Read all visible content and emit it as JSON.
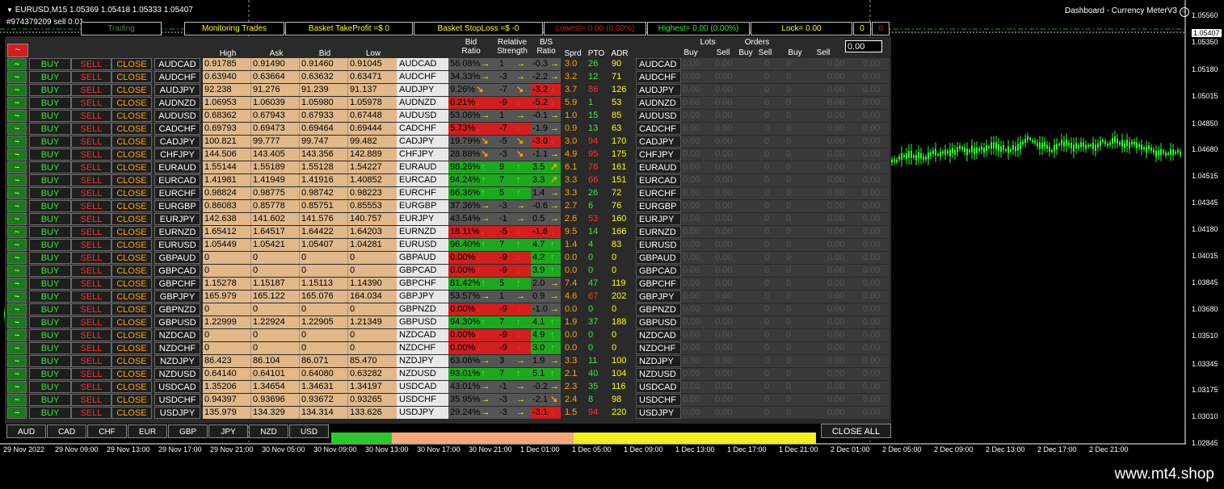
{
  "window": {
    "symbol_line": "EURUSD,M15  1.05369 1.05418 1.05333 1.05407",
    "account_line": "#974379209 sell 0.01",
    "indicator_name": "Dashboard - Currency MeterV3"
  },
  "top_bar": {
    "trading": "Trading",
    "monitoring": "Monitoring Trades",
    "basket_tp": "Basket TakeProfit =$ 0",
    "basket_sl": "Basket StopLoss =$ -0",
    "lowest": "Lowest= 0.00 (0.00%)",
    "highest": "Highest= 0.00 (0.00%)",
    "lock": "Lock= 0.00",
    "zero1": "0",
    "zero2": "0",
    "input_value": "0.00"
  },
  "headers": {
    "high": "High",
    "ask": "Ask",
    "bid": "Bid",
    "low": "Low",
    "bid_ratio_1": "Bid",
    "bid_ratio_2": "Ratio",
    "rel_1": "Relative",
    "rel_2": "Strength",
    "bs_1": "B/S",
    "bs_2": "Ratio",
    "sprd": "Sprd",
    "pto": "PTO",
    "adr": "ADR",
    "lots": "Lots",
    "orders": "Orders",
    "buy1": "Buy",
    "sell1": "Sell",
    "buy2": "Buy",
    "sell2": "Sell",
    "buy3": "Buy",
    "sell3": "Sell"
  },
  "buttons": {
    "buy": "BUY",
    "sell": "SELL",
    "close": "CLOSE",
    "toggle": "~",
    "close_all": "CLOSE ALL"
  },
  "colors": {
    "up": "#1fa81f",
    "down": "#d11f1f",
    "neutral": "#555555",
    "price_bg": "#e0b88a",
    "arrow_up": "#33ee33",
    "arrow_down": "#ff3030",
    "arrow_right": "#ffff00",
    "arrow_diag": "#ffa500"
  },
  "rows": [
    {
      "sym": "AUDCAD",
      "high": "0.91785",
      "ask": "0.91490",
      "bid": "0.91460",
      "low": "0.91045",
      "ratio": "56.08%",
      "rs": "1",
      "rs_dir": "r",
      "bs": "-0.3",
      "bs_dir": "r",
      "sprd": "3.0",
      "pto": "26",
      "adr": "90"
    },
    {
      "sym": "AUDCHF",
      "high": "0.63940",
      "ask": "0.63664",
      "bid": "0.63632",
      "low": "0.63471",
      "ratio": "34.33%",
      "rs": "-3",
      "rs_dir": "r",
      "bs": "-2.2",
      "bs_dir": "r",
      "sprd": "3.2",
      "pto": "12",
      "adr": "71"
    },
    {
      "sym": "AUDJPY",
      "high": "92.238",
      "ask": "91.276",
      "bid": "91.239",
      "low": "91.137",
      "ratio": "9.26%",
      "rs": "-7",
      "rs_dir": "dr",
      "bs": "-3.2",
      "bs_dir": "d",
      "sprd": "3.7",
      "pto": "86",
      "adr": "126"
    },
    {
      "sym": "AUDNZD",
      "high": "1.06953",
      "ask": "1.06039",
      "bid": "1.05980",
      "low": "1.05978",
      "ratio": "0.21%",
      "rs": "-9",
      "rs_dir": "d",
      "bs": "-5.2",
      "bs_dir": "d",
      "sprd": "5.9",
      "pto": "1",
      "adr": "53"
    },
    {
      "sym": "AUDUSD",
      "high": "0.68362",
      "ask": "0.67943",
      "bid": "0.67933",
      "low": "0.67448",
      "ratio": "53.06%",
      "rs": "1",
      "rs_dir": "r",
      "bs": "-0.1",
      "bs_dir": "r",
      "sprd": "1.0",
      "pto": "15",
      "adr": "85"
    },
    {
      "sym": "CADCHF",
      "high": "0.69793",
      "ask": "0.69473",
      "bid": "0.69464",
      "low": "0.69444",
      "ratio": "5.73%",
      "rs": "-7",
      "rs_dir": "d",
      "bs": "-1.9",
      "bs_dir": "r",
      "sprd": "0.9",
      "pto": "13",
      "adr": "63"
    },
    {
      "sym": "CADJPY",
      "high": "100.821",
      "ask": "99.777",
      "bid": "99.747",
      "low": "99.482",
      "ratio": "19.79%",
      "rs": "-5",
      "rs_dir": "dr",
      "bs": "-3.0",
      "bs_dir": "d",
      "sprd": "3.0",
      "pto": "94",
      "adr": "170"
    },
    {
      "sym": "CHFJPY",
      "high": "144.506",
      "ask": "143.405",
      "bid": "143.356",
      "low": "142.889",
      "ratio": "28.88%",
      "rs": "-3",
      "rs_dir": "dr",
      "bs": "-1.1",
      "bs_dir": "r",
      "sprd": "4.9",
      "pto": "95",
      "adr": "175"
    },
    {
      "sym": "EURAUD",
      "high": "1.55144",
      "ask": "1.55189",
      "bid": "1.55128",
      "low": "1.54227",
      "ratio": "98.26%",
      "rs": "9",
      "rs_dir": "u",
      "bs": "3.5",
      "bs_dir": "ur",
      "sprd": "6.1",
      "pto": "76",
      "adr": "161"
    },
    {
      "sym": "EURCAD",
      "high": "1.41981",
      "ask": "1.41949",
      "bid": "1.41916",
      "low": "1.40852",
      "ratio": "94.24%",
      "rs": "7",
      "rs_dir": "u",
      "bs": "3.3",
      "bs_dir": "ur",
      "sprd": "3.3",
      "pto": "66",
      "adr": "151"
    },
    {
      "sym": "EURCHF",
      "high": "0.98824",
      "ask": "0.98775",
      "bid": "0.98742",
      "low": "0.98223",
      "ratio": "86.36%",
      "rs": "5",
      "rs_dir": "u",
      "bs": "1.4",
      "bs_dir": "r",
      "sprd": "3.3",
      "pto": "26",
      "adr": "72"
    },
    {
      "sym": "EURGBP",
      "high": "0.86083",
      "ask": "0.85778",
      "bid": "0.85751",
      "low": "0.85553",
      "ratio": "37.36%",
      "rs": "-3",
      "rs_dir": "r",
      "bs": "-0.6",
      "bs_dir": "r",
      "sprd": "2.7",
      "pto": "6",
      "adr": "76"
    },
    {
      "sym": "EURJPY",
      "high": "142.638",
      "ask": "141.602",
      "bid": "141.576",
      "low": "140.757",
      "ratio": "43.54%",
      "rs": "-1",
      "rs_dir": "r",
      "bs": "0.5",
      "bs_dir": "r",
      "sprd": "2.6",
      "pto": "53",
      "adr": "160"
    },
    {
      "sym": "EURNZD",
      "high": "1.65412",
      "ask": "1.64517",
      "bid": "1.64422",
      "low": "1.64203",
      "ratio": "18.11%",
      "rs": "-5",
      "rs_dir": "d",
      "bs": "-1.6",
      "bs_dir": "d",
      "sprd": "9.5",
      "pto": "14",
      "adr": "166"
    },
    {
      "sym": "EURUSD",
      "high": "1.05449",
      "ask": "1.05421",
      "bid": "1.05407",
      "low": "1.04281",
      "ratio": "96.40%",
      "rs": "7",
      "rs_dir": "u",
      "bs": "4.7",
      "bs_dir": "u",
      "sprd": "1.4",
      "pto": "4",
      "adr": "83"
    },
    {
      "sym": "GBPAUD",
      "high": "0",
      "ask": "0",
      "bid": "0",
      "low": "0",
      "ratio": "0.00%",
      "rs": "-9",
      "rs_dir": "d",
      "bs": "4.2",
      "bs_dir": "u",
      "sprd": "0.0",
      "pto": "0",
      "adr": "0"
    },
    {
      "sym": "GBPCAD",
      "high": "0",
      "ask": "0",
      "bid": "0",
      "low": "0",
      "ratio": "0.00%",
      "rs": "-9",
      "rs_dir": "d",
      "bs": "3.9",
      "bs_dir": "u",
      "sprd": "0.0",
      "pto": "0",
      "adr": "0"
    },
    {
      "sym": "GBPCHF",
      "high": "1.15278",
      "ask": "1.15187",
      "bid": "1.15113",
      "low": "1.14390",
      "ratio": "81.42%",
      "rs": "5",
      "rs_dir": "u",
      "bs": "2.0",
      "bs_dir": "r",
      "sprd": "7.4",
      "pto": "47",
      "adr": "119"
    },
    {
      "sym": "GBPJPY",
      "high": "165.979",
      "ask": "165.122",
      "bid": "165.076",
      "low": "164.034",
      "ratio": "53.57%",
      "rs": "1",
      "rs_dir": "r",
      "bs": "0.9",
      "bs_dir": "r",
      "sprd": "4.6",
      "pto": "67",
      "adr": "202"
    },
    {
      "sym": "GBPNZD",
      "high": "0",
      "ask": "0",
      "bid": "0",
      "low": "0",
      "ratio": "0.00%",
      "rs": "-9",
      "rs_dir": "d",
      "bs": "-1.0",
      "bs_dir": "r",
      "sprd": "0.0",
      "pto": "0",
      "adr": "0"
    },
    {
      "sym": "GBPUSD",
      "high": "1.22999",
      "ask": "1.22924",
      "bid": "1.22905",
      "low": "1.21349",
      "ratio": "94.30%",
      "rs": "7",
      "rs_dir": "u",
      "bs": "4.1",
      "bs_dir": "u",
      "sprd": "1.9",
      "pto": "37",
      "adr": "188"
    },
    {
      "sym": "NZDCAD",
      "high": "0",
      "ask": "0",
      "bid": "0",
      "low": "0",
      "ratio": "0.00%",
      "rs": "-9",
      "rs_dir": "d",
      "bs": "4.9",
      "bs_dir": "u",
      "sprd": "0.0",
      "pto": "0",
      "adr": "0"
    },
    {
      "sym": "NZDCHF",
      "high": "0",
      "ask": "0",
      "bid": "0",
      "low": "0",
      "ratio": "0.00%",
      "rs": "-9",
      "rs_dir": "d",
      "bs": "3.0",
      "bs_dir": "u",
      "sprd": "0.0",
      "pto": "0",
      "adr": "0"
    },
    {
      "sym": "NZDJPY",
      "high": "86.423",
      "ask": "86.104",
      "bid": "86.071",
      "low": "85.470",
      "ratio": "63.06%",
      "rs": "3",
      "rs_dir": "r",
      "bs": "1.9",
      "bs_dir": "r",
      "sprd": "3.3",
      "pto": "11",
      "adr": "100"
    },
    {
      "sym": "NZDUSD",
      "high": "0.64140",
      "ask": "0.64101",
      "bid": "0.64080",
      "low": "0.63282",
      "ratio": "93.01%",
      "rs": "7",
      "rs_dir": "u",
      "bs": "5.1",
      "bs_dir": "u",
      "sprd": "2.1",
      "pto": "40",
      "adr": "104"
    },
    {
      "sym": "USDCAD",
      "high": "1.35206",
      "ask": "1.34654",
      "bid": "1.34631",
      "low": "1.34197",
      "ratio": "43.01%",
      "rs": "-1",
      "rs_dir": "r",
      "bs": "-0.2",
      "bs_dir": "r",
      "sprd": "2.3",
      "pto": "35",
      "adr": "116"
    },
    {
      "sym": "USDCHF",
      "high": "0.94397",
      "ask": "0.93696",
      "bid": "0.93672",
      "low": "0.93265",
      "ratio": "35.95%",
      "rs": "-3",
      "rs_dir": "r",
      "bs": "-2.1",
      "bs_dir": "dr",
      "sprd": "2.4",
      "pto": "8",
      "adr": "98"
    },
    {
      "sym": "USDJPY",
      "high": "135.979",
      "ask": "134.329",
      "bid": "134.314",
      "low": "133.626",
      "ratio": "29.24%",
      "rs": "-3",
      "rs_dir": "r",
      "bs": "-3.1",
      "bs_dir": "d",
      "sprd": "1.5",
      "pto": "94",
      "adr": "220"
    }
  ],
  "lots_zero": "0.00",
  "currency_tabs": [
    "AUD",
    "CAD",
    "CHF",
    "EUR",
    "GBP",
    "JPY",
    "NZD",
    "USD"
  ],
  "price_axis": [
    "1.05560",
    "1.05407",
    "1.05350",
    "1.05180",
    "1.05015",
    "1.04850",
    "1.04680",
    "1.04515",
    "1.04345",
    "1.04180",
    "1.04015",
    "1.03845",
    "1.03680",
    "1.03510",
    "1.03345",
    "1.03175",
    "1.03010",
    "1.02845"
  ],
  "time_axis": [
    "29 Nov 2022",
    "29 Nov 09:00",
    "29 Nov 13:00",
    "29 Nov 17:00",
    "29 Nov 21:00",
    "30 Nov 05:00",
    "30 Nov 09:00",
    "30 Nov 13:00",
    "30 Nov 17:00",
    "30 Nov 21:00",
    "1 Dec 01:00",
    "1 Dec 05:00",
    "1 Dec 09:00",
    "1 Dec 13:00",
    "1 Dec 17:00",
    "1 Dec 21:00",
    "2 Dec 01:00",
    "2 Dec 05:00",
    "2 Dec 09:00",
    "2 Dec 13:00",
    "2 Dec 17:00",
    "2 Dec 21:00"
  ],
  "footer": {
    "site": "www.mt4.shop"
  }
}
